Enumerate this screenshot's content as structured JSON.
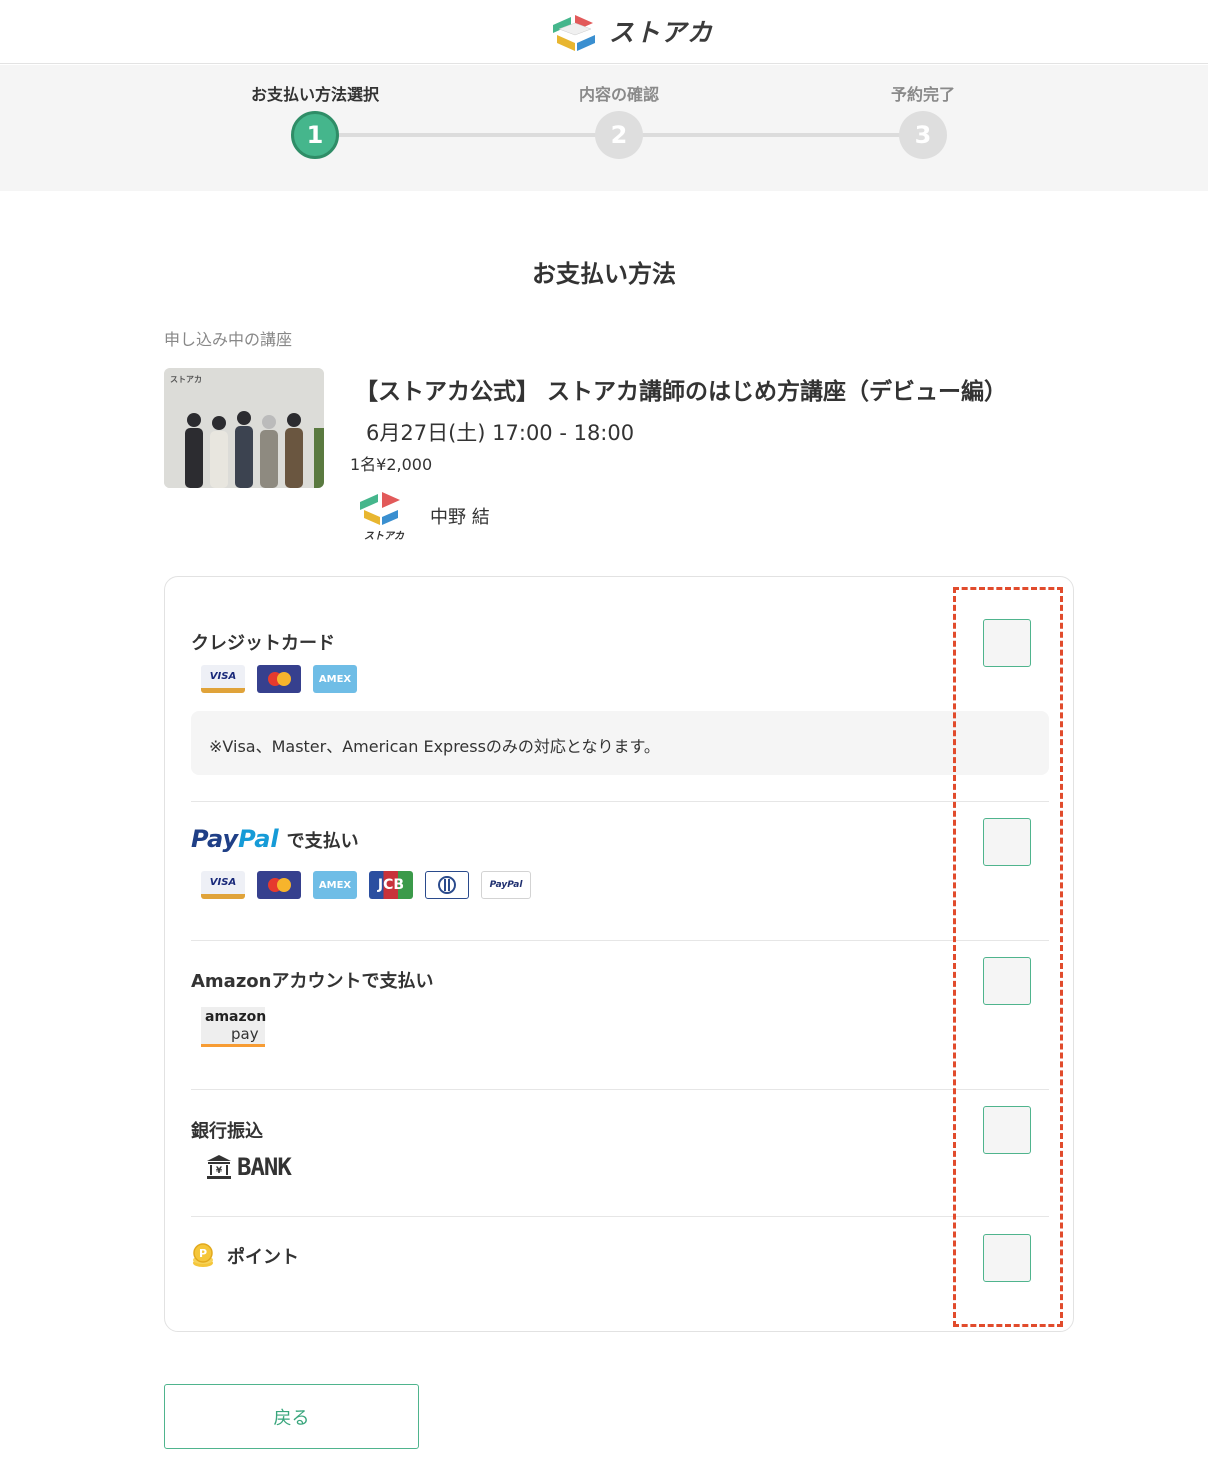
{
  "header": {
    "logo_text": "ストアカ"
  },
  "stepper": {
    "steps": [
      {
        "label": "お支払い方法選択",
        "number": "1"
      },
      {
        "label": "内容の確認",
        "number": "2"
      },
      {
        "label": "予約完了",
        "number": "3"
      }
    ],
    "current": 1
  },
  "page_title": "お支払い方法",
  "course_section": {
    "label": "申し込み中の講座",
    "title": "【ストアカ公式】 ストアカ講師のはじめ方講座（デビュー編）",
    "date": "6月27日(土) 17:00 - 18:00",
    "price": "1名¥2,000",
    "thumbnail_logo": "ストアカ",
    "instructor_avatar_text": "ストアカ",
    "instructor_name": "中野 結"
  },
  "payment": {
    "credit_card": {
      "title": "クレジットカード",
      "cards": [
        "VISA",
        "mastercard",
        "AMEX"
      ],
      "note": "※Visa、Master、American Expressのみの対応となります。"
    },
    "paypal": {
      "logo_pay": "Pay",
      "logo_pal": "Pal",
      "suffix": "で支払い",
      "cards": [
        "VISA",
        "mastercard",
        "AMEX",
        "JCB",
        "Diners",
        "PayPal"
      ]
    },
    "amazon": {
      "title": "Amazonアカウントで支払い",
      "logo_top": "amazon",
      "logo_bottom": "pay"
    },
    "bank": {
      "title": "銀行振込",
      "logo_text": "BANK"
    },
    "points": {
      "title": "ポイント"
    }
  },
  "back_button": "戻る",
  "colors": {
    "accent": "#45b68c",
    "highlight": "#e14b2c"
  }
}
